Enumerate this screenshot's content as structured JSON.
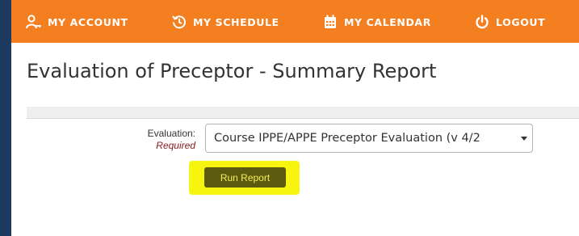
{
  "nav": {
    "account_label": "MY ACCOUNT",
    "schedule_label": "MY SCHEDULE",
    "calendar_label": "MY CALENDAR",
    "logout_label": "LOGOUT",
    "bar_color": "#f47f20"
  },
  "page": {
    "title": "Evaluation of Preceptor - Summary Report"
  },
  "form": {
    "evaluation_label": "Evaluation:",
    "required_label": "Required",
    "evaluation_selected": "Course IPPE/APPE Preceptor Evaluation (v 4/2",
    "run_report_label": "Run Report",
    "highlight_color": "#f7f410"
  },
  "icons": {
    "account": "user-key-icon",
    "schedule": "history-clock-icon",
    "calendar": "calendar-icon",
    "logout": "power-icon"
  }
}
